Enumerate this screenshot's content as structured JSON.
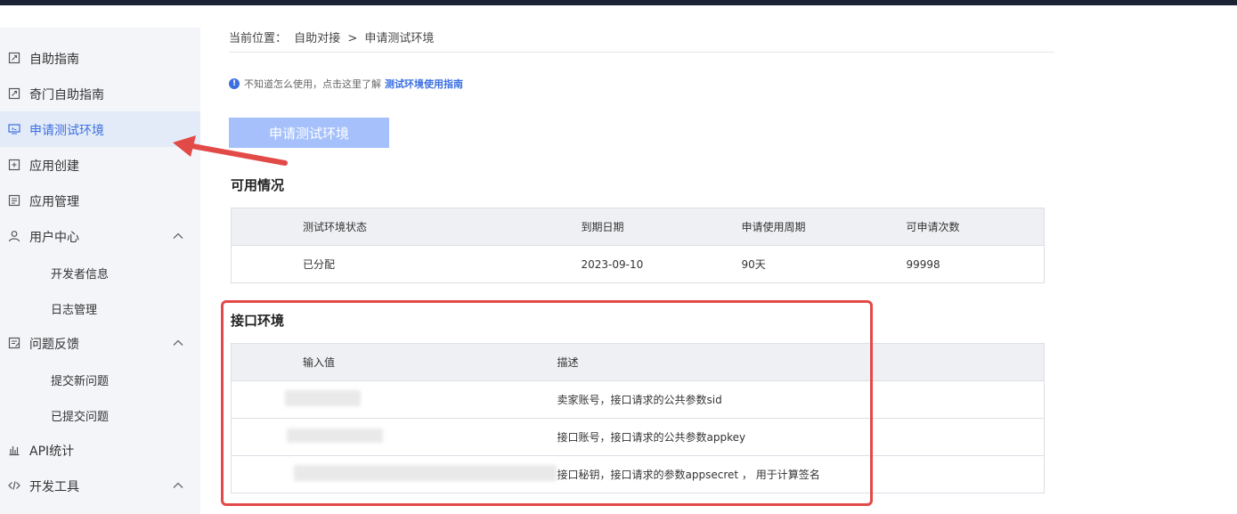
{
  "sidebar": {
    "items": [
      {
        "label": "自助指南",
        "icon": "guide-icon"
      },
      {
        "label": "奇门自助指南",
        "icon": "guide-icon"
      },
      {
        "label": "申请测试环境",
        "icon": "monitor-icon",
        "active": true
      },
      {
        "label": "应用创建",
        "icon": "add-app-icon"
      },
      {
        "label": "应用管理",
        "icon": "manage-icon"
      },
      {
        "label": "用户中心",
        "icon": "user-icon",
        "expanded": true
      },
      {
        "label": "开发者信息",
        "sub": true
      },
      {
        "label": "日志管理",
        "sub": true
      },
      {
        "label": "问题反馈",
        "icon": "feedback-icon",
        "expanded": true
      },
      {
        "label": "提交新问题",
        "sub": true
      },
      {
        "label": "已提交问题",
        "sub": true
      },
      {
        "label": "API统计",
        "icon": "bar-chart-icon"
      },
      {
        "label": "开发工具",
        "icon": "code-icon",
        "expanded": true
      }
    ]
  },
  "breadcrumb": {
    "prefix": "当前位置：",
    "parent": "自助对接",
    "separator": ">",
    "current": "申请测试环境"
  },
  "notice": {
    "text": "不知道怎么使用，点击这里了解",
    "link": "测试环境使用指南"
  },
  "apply_button": "申请测试环境",
  "availability": {
    "title": "可用情况",
    "headers": [
      "测试环境状态",
      "到期日期",
      "申请使用周期",
      "可申请次数"
    ],
    "row": [
      "已分配",
      "2023-09-10",
      "90天",
      "99998"
    ]
  },
  "interface": {
    "title": "接口环境",
    "headers": [
      "输入值",
      "描述"
    ],
    "rows": [
      {
        "value": "",
        "desc": "卖家账号，接口请求的公共参数sid"
      },
      {
        "value": "",
        "desc": "接口账号，接口请求的公共参数appkey"
      },
      {
        "value": "",
        "desc": "接口秘钥，接口请求的参数appsecret ， 用于计算签名"
      }
    ]
  },
  "colors": {
    "accent": "#3b6fe0",
    "button_disabled": "#a5c0fb",
    "annotation_red": "#e24a48"
  }
}
